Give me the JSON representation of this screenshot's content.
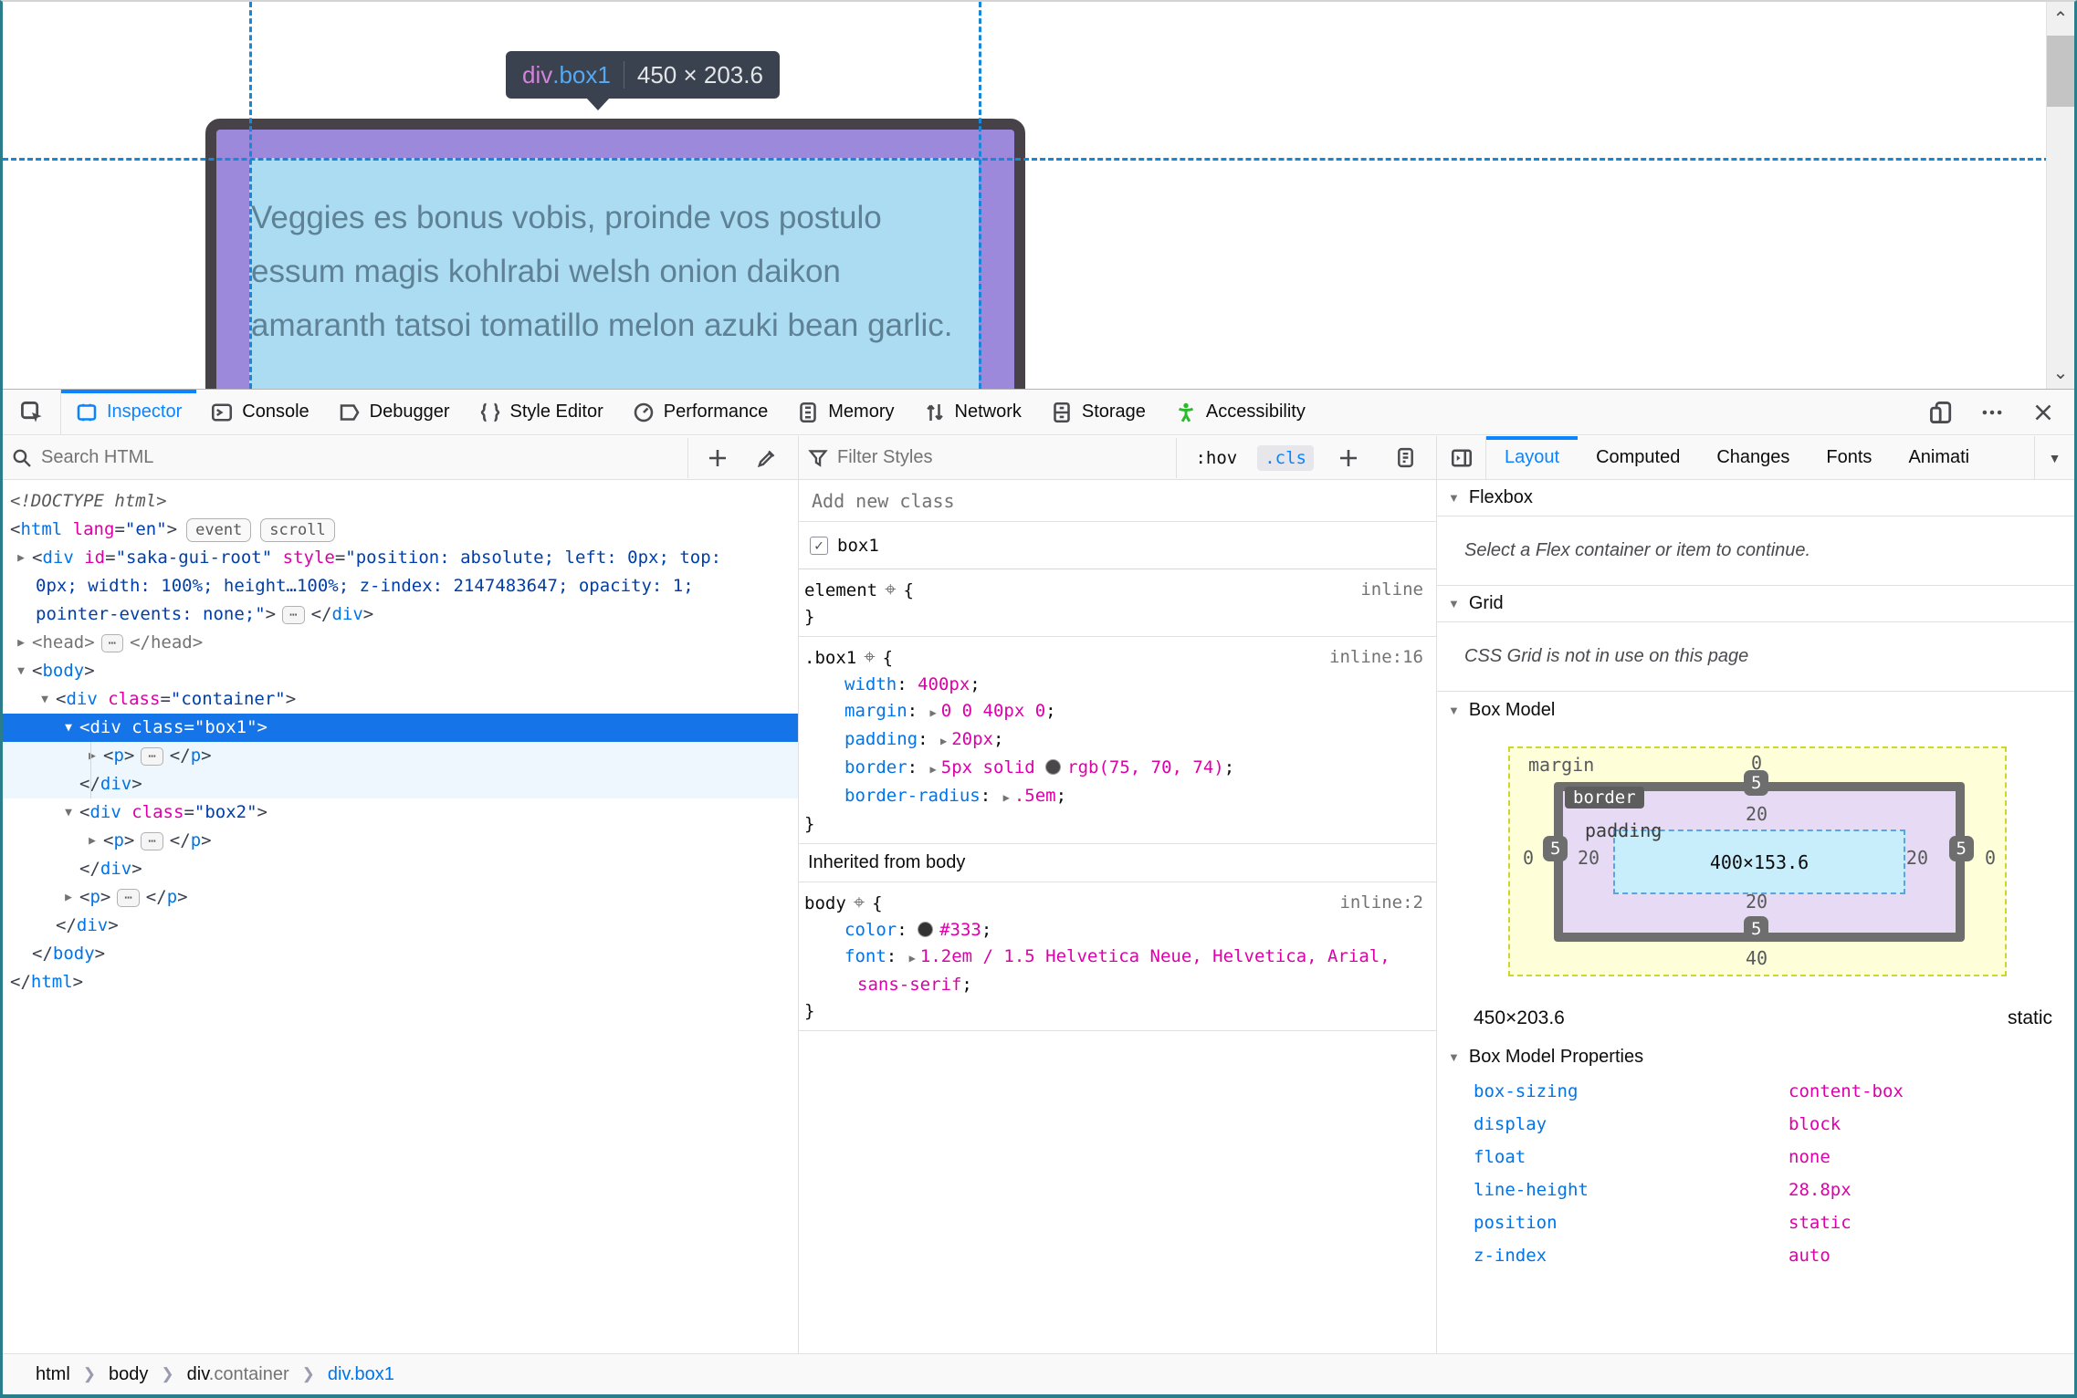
{
  "page": {
    "tooltip": {
      "tag": "div",
      "class": ".box1",
      "dims": "450 × 203.6"
    },
    "box_text": "Veggies es bonus vobis, proinde vos postulo essum magis kohlrabi welsh onion daikon amaranth tatsoi tomatillo melon azuki bean garlic.",
    "colors": {
      "border": "#474247",
      "padding": "#9d89dc",
      "content": "#abdcf2",
      "guide": "#1787d8"
    }
  },
  "devtools": {
    "tabs": [
      {
        "label": "Inspector",
        "icon": "inspector-icon",
        "active": true
      },
      {
        "label": "Console",
        "icon": "console-icon"
      },
      {
        "label": "Debugger",
        "icon": "debugger-icon"
      },
      {
        "label": "Style Editor",
        "icon": "style-editor-icon"
      },
      {
        "label": "Performance",
        "icon": "performance-icon"
      },
      {
        "label": "Memory",
        "icon": "memory-icon"
      },
      {
        "label": "Network",
        "icon": "network-icon"
      },
      {
        "label": "Storage",
        "icon": "storage-icon"
      },
      {
        "label": "Accessibility",
        "icon": "accessibility-icon"
      }
    ]
  },
  "markup": {
    "search_placeholder": "Search HTML",
    "lines": [
      {
        "seg": [
          [
            "<!DOCTYPE html>",
            "d"
          ]
        ]
      },
      {
        "seg": [
          [
            "<",
            "b"
          ],
          [
            "html",
            "t"
          ],
          [
            " ",
            ""
          ],
          [
            "lang",
            "a"
          ],
          [
            "=",
            "b"
          ],
          [
            "\"en\"",
            "v"
          ],
          [
            ">",
            "b"
          ]
        ],
        "badges": [
          "event",
          "scroll"
        ]
      },
      {
        "tw": "r",
        "seg": [
          [
            "<",
            "b"
          ],
          [
            "div",
            "t"
          ],
          [
            " ",
            ""
          ],
          [
            "id",
            "a"
          ],
          [
            "=",
            "b"
          ],
          [
            "\"saka-gui-root\"",
            "v"
          ],
          [
            " ",
            ""
          ],
          [
            "style",
            "a"
          ],
          [
            "=",
            "b"
          ],
          [
            "\"position: absolute; left: 0px; top:",
            "v"
          ]
        ]
      },
      {
        "cont": 1,
        "seg": [
          [
            "0px; width: 100%; height…100%; z-index: 2147483647; opacity: 1;",
            "v"
          ]
        ]
      },
      {
        "cont": 1,
        "seg": [
          [
            "pointer-events: none;\"",
            "v"
          ],
          [
            ">",
            "b"
          ],
          [
            "⋯",
            "dots"
          ],
          [
            "</",
            "b"
          ],
          [
            "div",
            "t"
          ],
          [
            ">",
            "b"
          ]
        ]
      },
      {
        "tw": "r",
        "seg": [
          [
            "<head>",
            "g"
          ],
          [
            "⋯",
            "dots"
          ],
          [
            "</head>",
            "g"
          ]
        ]
      },
      {
        "tw": "d",
        "seg": [
          [
            "<",
            "b"
          ],
          [
            "body",
            "t"
          ],
          [
            ">",
            "b"
          ]
        ]
      },
      {
        "tw": "d",
        "ind": 1,
        "seg": [
          [
            "<",
            "b"
          ],
          [
            "div",
            "t"
          ],
          [
            " ",
            ""
          ],
          [
            "class",
            "a"
          ],
          [
            "=",
            "b"
          ],
          [
            "\"container\"",
            "v"
          ],
          [
            ">",
            "b"
          ]
        ]
      },
      {
        "tw": "d",
        "ind": 2,
        "sel": 1,
        "seg": [
          [
            "<",
            "b"
          ],
          [
            "div",
            "t"
          ],
          [
            " ",
            ""
          ],
          [
            "class",
            "a"
          ],
          [
            "=",
            "b"
          ],
          [
            "\"box1\"",
            "v"
          ],
          [
            ">",
            "b"
          ]
        ]
      },
      {
        "tw": "r",
        "ind": 3,
        "shade": 1,
        "seg": [
          [
            "<",
            "b"
          ],
          [
            "p",
            "t"
          ],
          [
            ">",
            "b"
          ],
          [
            "⋯",
            "dots"
          ],
          [
            "</",
            "b"
          ],
          [
            "p",
            "t"
          ],
          [
            ">",
            "b"
          ]
        ]
      },
      {
        "ind": 2,
        "g": 1,
        "shade": 1,
        "seg": [
          [
            "</",
            "b"
          ],
          [
            "div",
            "t"
          ],
          [
            ">",
            "b"
          ]
        ]
      },
      {
        "tw": "d",
        "ind": 2,
        "seg": [
          [
            "<",
            "b"
          ],
          [
            "div",
            "t"
          ],
          [
            " ",
            ""
          ],
          [
            "class",
            "a"
          ],
          [
            "=",
            "b"
          ],
          [
            "\"box2\"",
            "v"
          ],
          [
            ">",
            "b"
          ]
        ]
      },
      {
        "tw": "r",
        "ind": 3,
        "seg": [
          [
            "<",
            "b"
          ],
          [
            "p",
            "t"
          ],
          [
            ">",
            "b"
          ],
          [
            "⋯",
            "dots"
          ],
          [
            "</",
            "b"
          ],
          [
            "p",
            "t"
          ],
          [
            ">",
            "b"
          ]
        ]
      },
      {
        "ind": 2,
        "g": 1,
        "seg": [
          [
            "</",
            "b"
          ],
          [
            "div",
            "t"
          ],
          [
            ">",
            "b"
          ]
        ]
      },
      {
        "tw": "r",
        "ind": 2,
        "seg": [
          [
            "<",
            "b"
          ],
          [
            "p",
            "t"
          ],
          [
            ">",
            "b"
          ],
          [
            "⋯",
            "dots"
          ],
          [
            "</",
            "b"
          ],
          [
            "p",
            "t"
          ],
          [
            ">",
            "b"
          ]
        ]
      },
      {
        "ind": 1,
        "g": 1,
        "seg": [
          [
            "</",
            "b"
          ],
          [
            "div",
            "t"
          ],
          [
            ">",
            "b"
          ]
        ]
      },
      {
        "ind": 0,
        "g": 1,
        "seg": [
          [
            "</",
            "b"
          ],
          [
            "body",
            "t"
          ],
          [
            ">",
            "b"
          ]
        ]
      },
      {
        "ind": 0,
        "seg": [
          [
            "</",
            "b"
          ],
          [
            "html",
            "t"
          ],
          [
            ">",
            "b"
          ]
        ]
      }
    ]
  },
  "rules": {
    "filter_placeholder": "Filter Styles",
    "hov_label": ":hov",
    "cls_label": ".cls",
    "new_class_placeholder": "Add new class",
    "class_toggle": {
      "label": "box1",
      "checked": true
    },
    "blocks": [
      {
        "selector": "element",
        "loc": "inline",
        "decls": []
      },
      {
        "selector": ".box1",
        "loc": "inline:16",
        "decls": [
          {
            "name": "width",
            "post": "400px"
          },
          {
            "name": "margin",
            "expand": true,
            "post": "0 0 40px 0"
          },
          {
            "name": "padding",
            "expand": true,
            "post": "20px"
          },
          {
            "name": "border",
            "expand": true,
            "pre": "5px solid ",
            "swatch": "#4b464a",
            "post": "rgb(75, 70, 74)"
          },
          {
            "name": "border-radius",
            "expand": true,
            "post": ".5em"
          }
        ]
      },
      {
        "header": "Inherited from body"
      },
      {
        "selector": "body",
        "loc": "inline:2",
        "decls": [
          {
            "name": "color",
            "swatch": "#333333",
            "post": "#333"
          },
          {
            "name": "font",
            "expand": true,
            "post": "1.2em / 1.5 Helvetica Neue, Helvetica, Arial,",
            "cont": "sans-serif"
          }
        ]
      }
    ]
  },
  "layout_panel": {
    "tabs": [
      "Layout",
      "Computed",
      "Changes",
      "Fonts",
      "Animati"
    ],
    "flexbox": {
      "header": "Flexbox",
      "message": "Select a Flex container or item to continue."
    },
    "grid": {
      "header": "Grid",
      "message": "CSS Grid is not in use on this page"
    },
    "box_model": {
      "header": "Box Model",
      "margin_label": "margin",
      "border_label": "border",
      "padding_label": "padding",
      "margin": {
        "top": "0",
        "right": "0",
        "bottom": "40",
        "left": "0"
      },
      "border": {
        "top": "5",
        "right": "5",
        "bottom": "5",
        "left": "5"
      },
      "padding": {
        "top": "20",
        "right": "20",
        "bottom": "20",
        "left": "20"
      },
      "content": "400×153.6",
      "summary_dims": "450×203.6",
      "summary_position": "static",
      "props_header": "Box Model Properties",
      "props": [
        {
          "name": "box-sizing",
          "value": "content-box"
        },
        {
          "name": "display",
          "value": "block"
        },
        {
          "name": "float",
          "value": "none"
        },
        {
          "name": "line-height",
          "value": "28.8px"
        },
        {
          "name": "position",
          "value": "static"
        },
        {
          "name": "z-index",
          "value": "auto"
        }
      ]
    }
  },
  "breadcrumb": [
    {
      "label": "html"
    },
    {
      "label": "body"
    },
    {
      "label": "div",
      "suffix": ".container"
    },
    {
      "label": "div.box1",
      "active": true
    }
  ]
}
